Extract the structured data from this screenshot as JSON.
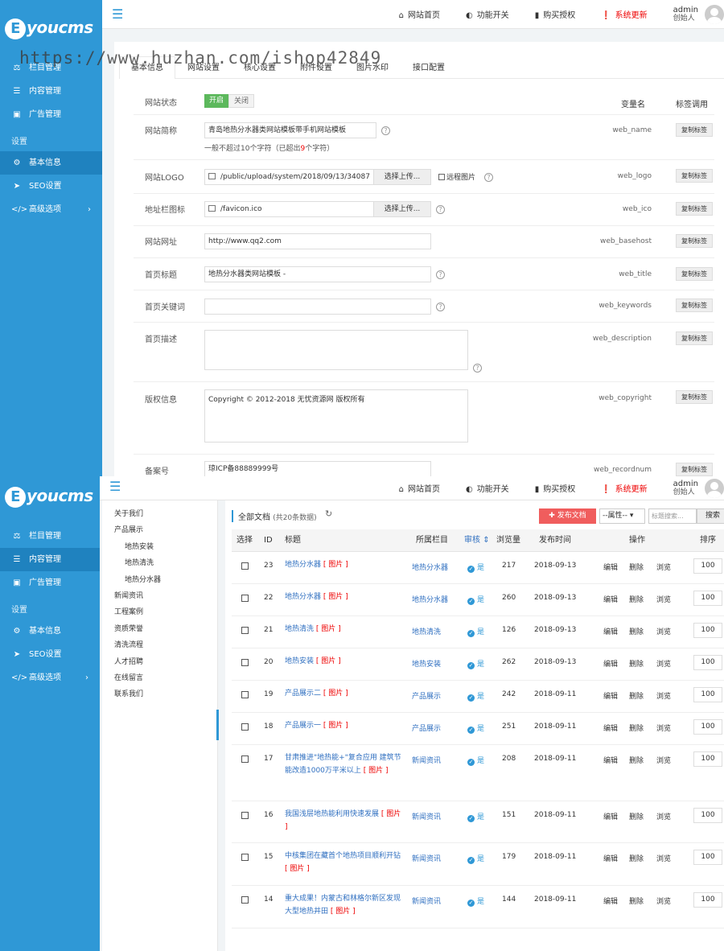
{
  "brand": {
    "logo_letter": "E",
    "logo_text": "youcms"
  },
  "watermark": "https://www.huzhan.com/ishop42849",
  "topbar": {
    "home": "网站首页",
    "features": "功能开关",
    "license": "购买授权",
    "update": "系统更新",
    "user": "admin",
    "role": "创始人"
  },
  "sidebar": {
    "items": [
      {
        "icon": "sitemap-icon",
        "label": "栏目管理"
      },
      {
        "icon": "list-icon",
        "label": "内容管理"
      },
      {
        "icon": "image-icon",
        "label": "广告管理"
      }
    ],
    "section": "设置",
    "settings": [
      {
        "icon": "gear-icon",
        "label": "基本信息"
      },
      {
        "icon": "paper-plane-icon",
        "label": "SEO设置"
      },
      {
        "icon": "code-icon",
        "label": "高级选项"
      }
    ]
  },
  "settings_page": {
    "tabs": [
      "基本信息",
      "网站设置",
      "核心设置",
      "附件设置",
      "图片水印",
      "接口配置"
    ],
    "col_varname": "变量名",
    "col_tag": "标签调用",
    "copy_label": "复制标签",
    "upload_label": "选择上传...",
    "remote_label": "远程图片",
    "fields": {
      "status": {
        "label": "网站状态",
        "on": "开启",
        "off": "关闭"
      },
      "name": {
        "label": "网站简称",
        "value": "青岛地热分水器类网站模板带手机网站模板",
        "var": "web_name"
      },
      "name_hint": {
        "pre": "一般不超过10个字符（已超出",
        "num": "9",
        "post": "个字符）"
      },
      "logo": {
        "label": "网站LOGO",
        "value": "/public/upload/system/2018/09/13/34087",
        "var": "web_logo"
      },
      "ico": {
        "label": "地址栏图标",
        "value": "/favicon.ico",
        "var": "web_ico"
      },
      "url": {
        "label": "网站网址",
        "value": "http://www.qq2.com",
        "var": "web_basehost"
      },
      "title": {
        "label": "首页标题",
        "value": "地热分水器类网站模板 -",
        "var": "web_title"
      },
      "keywords": {
        "label": "首页关键词",
        "value": "",
        "var": "web_keywords"
      },
      "description": {
        "label": "首页描述",
        "value": "",
        "var": "web_description"
      },
      "copyright": {
        "label": "版权信息",
        "value": "Copyright © 2012-2018  无忧资源网 版权所有",
        "var": "web_copyright"
      },
      "record": {
        "label": "备案号",
        "value": "琼ICP备88889999号",
        "var": "web_recordnum"
      }
    }
  },
  "tree": {
    "items": [
      {
        "label": "关于我们",
        "level": 0
      },
      {
        "label": "产品展示",
        "level": 0
      },
      {
        "label": "地热安装",
        "level": 1
      },
      {
        "label": "地热清洗",
        "level": 1
      },
      {
        "label": "地热分水器",
        "level": 1
      },
      {
        "label": "新闻资讯",
        "level": 0
      },
      {
        "label": "工程案例",
        "level": 0
      },
      {
        "label": "资质荣誉",
        "level": 0
      },
      {
        "label": "清洗流程",
        "level": 0
      },
      {
        "label": "人才招聘",
        "level": 0
      },
      {
        "label": "在线留言",
        "level": 0
      },
      {
        "label": "联系我们",
        "level": 0
      }
    ]
  },
  "docs": {
    "title": "全部文档",
    "count": "(共20条数据)",
    "add_button": "发布文档",
    "attr_select": "--属性--",
    "search_placeholder": "标题搜索...",
    "search_button": "搜索",
    "columns": [
      "选择",
      "ID",
      "标题",
      "所属栏目",
      "审核",
      "浏览量",
      "发布时间",
      "操作",
      "排序"
    ],
    "img_tag": "[ 图片 ]",
    "actions": [
      "编辑",
      "删除",
      "浏览"
    ],
    "approved": "是",
    "rows": [
      {
        "id": "23",
        "title": "地热分水器",
        "cat": "地热分水器",
        "views": "217",
        "date": "2018-09-13",
        "sort": "100"
      },
      {
        "id": "22",
        "title": "地热分水器",
        "cat": "地热分水器",
        "views": "260",
        "date": "2018-09-13",
        "sort": "100"
      },
      {
        "id": "21",
        "title": "地热清洗",
        "cat": "地热清洗",
        "views": "126",
        "date": "2018-09-13",
        "sort": "100"
      },
      {
        "id": "20",
        "title": "地热安装",
        "cat": "地热安装",
        "views": "262",
        "date": "2018-09-13",
        "sort": "100"
      },
      {
        "id": "19",
        "title": "产品展示二",
        "cat": "产品展示",
        "views": "242",
        "date": "2018-09-11",
        "sort": "100"
      },
      {
        "id": "18",
        "title": "产品展示一",
        "cat": "产品展示",
        "views": "251",
        "date": "2018-09-11",
        "sort": "100"
      },
      {
        "id": "17",
        "title": "甘肃推进\"地热能+\"复合应用 建筑节能改造1000万平米以上",
        "cat": "新闻资讯",
        "views": "208",
        "date": "2018-09-11",
        "sort": "100"
      },
      {
        "id": "16",
        "title": "我国浅层地热能利用快速发展",
        "cat": "新闻资讯",
        "views": "151",
        "date": "2018-09-11",
        "sort": "100"
      },
      {
        "id": "15",
        "title": "中核集团在藏首个地热项目顺利开钻",
        "cat": "新闻资讯",
        "views": "179",
        "date": "2018-09-11",
        "sort": "100"
      },
      {
        "id": "14",
        "title": "重大成果！内蒙古和林格尔新区发现大型地热井田",
        "cat": "新闻资讯",
        "views": "144",
        "date": "2018-09-11",
        "sort": "100"
      }
    ]
  }
}
